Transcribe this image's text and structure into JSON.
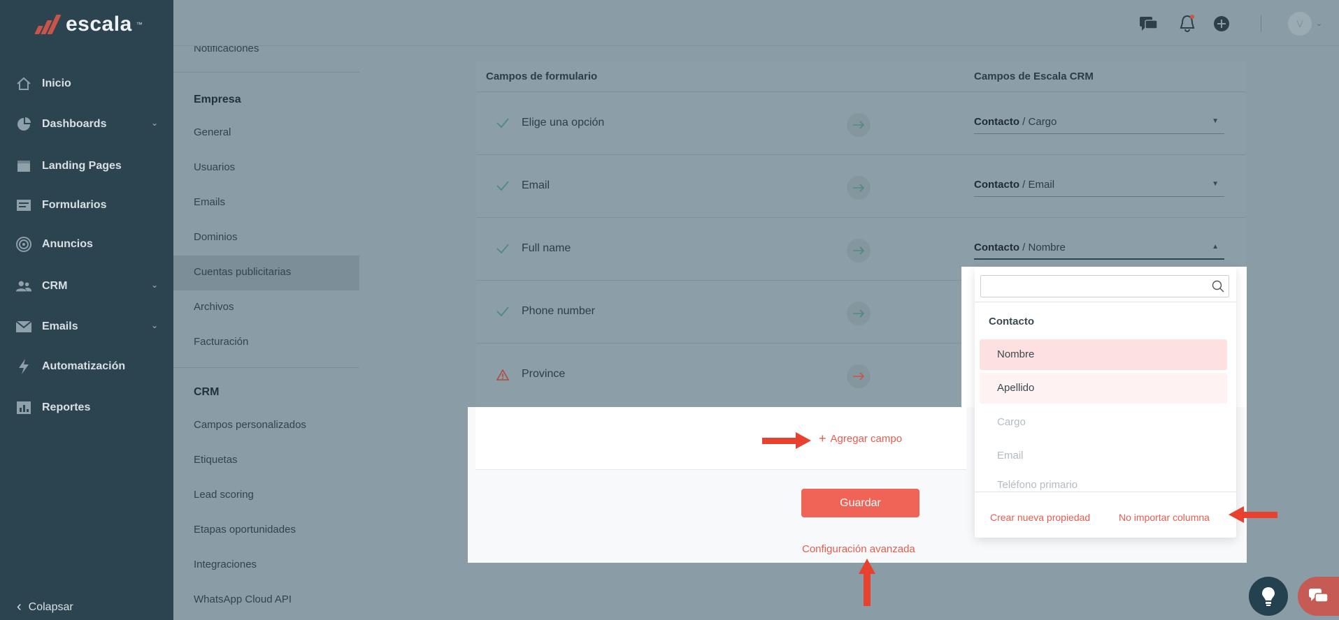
{
  "brand": {
    "name": "escala",
    "tm": "™"
  },
  "nav": {
    "items": [
      {
        "label": "Inicio",
        "icon": "home-icon"
      },
      {
        "label": "Dashboards",
        "icon": "pie-chart-icon",
        "expandable": true
      },
      {
        "label": "Landing Pages",
        "icon": "browser-window-icon"
      },
      {
        "label": "Formularios",
        "icon": "form-icon"
      },
      {
        "label": "Anuncios",
        "icon": "target-icon"
      },
      {
        "label": "CRM",
        "icon": "people-icon",
        "expandable": true
      },
      {
        "label": "Emails",
        "icon": "envelope-icon",
        "expandable": true
      },
      {
        "label": "Automatización",
        "icon": "lightning-icon"
      },
      {
        "label": "Reportes",
        "icon": "bar-chart-icon"
      }
    ],
    "collapse_label": "Colapsar"
  },
  "settings_menu": {
    "cut_item": "Notificaciones",
    "sections": [
      {
        "title": "Empresa",
        "items": [
          "General",
          "Usuarios",
          "Emails",
          "Dominios",
          "Cuentas publicitarias",
          "Archivos",
          "Facturación"
        ]
      },
      {
        "title": "CRM",
        "items": [
          "Campos personalizados",
          "Etiquetas",
          "Lead scoring",
          "Etapas oportunidades",
          "Integraciones",
          "WhatsApp Cloud API"
        ]
      }
    ],
    "active": "Cuentas publicitarias"
  },
  "topbar": {
    "icons": [
      "chat-icon",
      "bell-icon",
      "plus-circle-icon",
      "avatar"
    ],
    "avatar_initial": "V"
  },
  "mapping": {
    "headers": {
      "form": "Campos de formulario",
      "crm": "Campos de Escala CRM"
    },
    "rows": [
      {
        "label": "Elige una opción",
        "status": "ok",
        "object": "Contacto",
        "field": "Cargo"
      },
      {
        "label": "Email",
        "status": "ok",
        "object": "Contacto",
        "field": "Email"
      },
      {
        "label": "Full name",
        "status": "ok",
        "object": "Contacto",
        "field": "Nombre",
        "open": true
      },
      {
        "label": "Phone number",
        "status": "ok"
      },
      {
        "label": "Province",
        "status": "warning"
      }
    ],
    "separator": "/"
  },
  "actions": {
    "add_field": "Agregar campo",
    "save": "Guardar",
    "advanced": "Configuración avanzada"
  },
  "dropdown": {
    "search_placeholder": "",
    "group": "Contacto",
    "options": [
      {
        "label": "Nombre",
        "state": "selected"
      },
      {
        "label": "Apellido",
        "state": "hover"
      },
      {
        "label": "Cargo",
        "state": "disabled"
      },
      {
        "label": "Email",
        "state": "disabled"
      },
      {
        "label": "Teléfono primario",
        "state": "disabled"
      }
    ],
    "create_label": "Crear nueva propiedad",
    "skip_label": "No importar columna"
  },
  "colors": {
    "accent": "#ef6457",
    "nav_bg": "#2c4350",
    "overlay": "#8a9ca5",
    "selected_bg": "#fde1e1",
    "annotation": "#e8412d"
  }
}
